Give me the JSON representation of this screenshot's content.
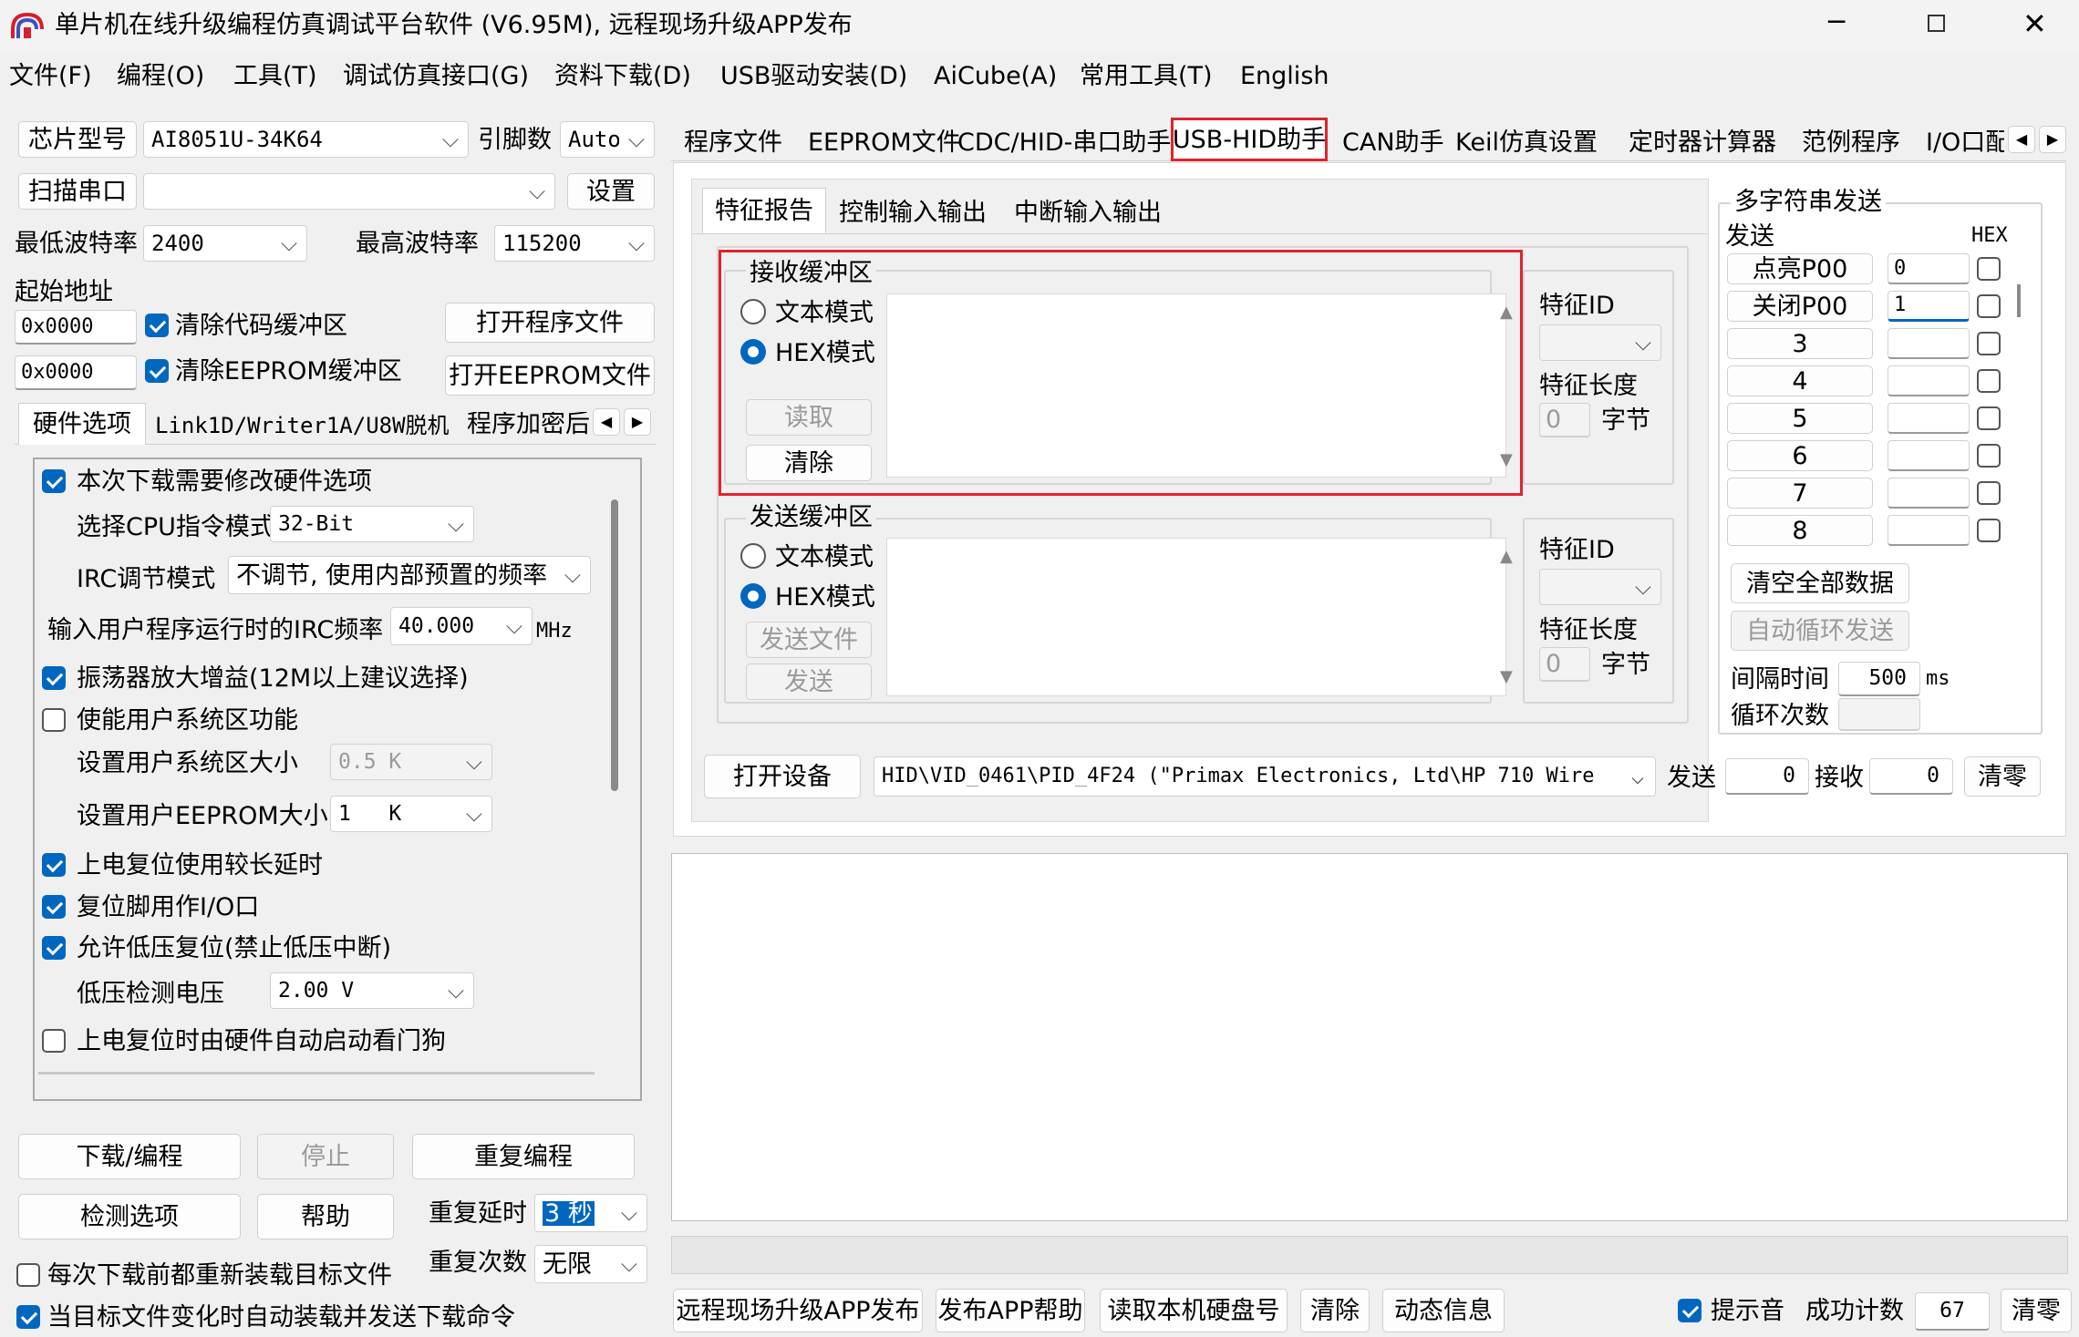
{
  "window": {
    "title": "单片机在线升级编程仿真调试平台软件 (V6.95M), 远程现场升级APP发布"
  },
  "menu": [
    "文件(F)",
    "编程(O)",
    "工具(T)",
    "调试仿真接口(G)",
    "资料下载(D)",
    "USB驱动安装(D)",
    "AiCube(A)",
    "常用工具(T)",
    "English"
  ],
  "left": {
    "chip_label": "芯片型号",
    "chip_value": "AI8051U-34K64",
    "pins_label": "引脚数",
    "pins_value": "Auto",
    "scan_label": "扫描串口",
    "port_value": "",
    "settings_label": "设置",
    "min_baud_label": "最低波特率",
    "min_baud_value": "2400",
    "max_baud_label": "最高波特率",
    "max_baud_value": "115200",
    "start_addr_label": "起始地址",
    "addr1": "0x0000",
    "clear_code": "清除代码缓冲区",
    "open_prog": "打开程序文件",
    "addr2": "0x0000",
    "clear_eeprom": "清除EEPROM缓冲区",
    "open_eeprom": "打开EEPROM文件",
    "tabs": [
      "硬件选项",
      "Link1D/Writer1A/U8W脱机",
      "程序加密后"
    ],
    "hw": {
      "opt1": "本次下载需要修改硬件选项",
      "cpu_label": "选择CPU指令模式",
      "cpu_value": "32-Bit",
      "irc_label": "IRC调节模式",
      "irc_value": "不调节, 使用内部预置的频率",
      "freq_label": "输入用户程序运行时的IRC频率",
      "freq_value": "40.000",
      "freq_unit": "MHz",
      "opt2": "振荡器放大增益(12M以上建议选择)",
      "opt3": "使能用户系统区功能",
      "sys_size_label": "设置用户系统区大小",
      "sys_size_value": "0.5 K",
      "eeprom_size_label": "设置用户EEPROM大小",
      "eeprom_size_value": "1   K",
      "opt4": "上电复位使用较长延时",
      "opt5": "复位脚用作I/O口",
      "opt6": "允许低压复位(禁止低压中断)",
      "lvd_label": "低压检测电压",
      "lvd_value": "2.00 V",
      "opt7": "上电复位时由硬件自动启动看门狗"
    },
    "download": "下载/编程",
    "stop": "停止",
    "reprogram": "重复编程",
    "check_opts": "检测选项",
    "help": "帮助",
    "repeat_delay_label": "重复延时",
    "repeat_delay_value": "3 秒",
    "repeat_count_label": "重复次数",
    "repeat_count_value": "无限",
    "reload_each": "每次下载前都重新装载目标文件",
    "auto_reload": "当目标文件变化时自动装载并发送下载命令"
  },
  "tabs": [
    "程序文件",
    "EEPROM文件",
    "CDC/HID-串口助手",
    "USB-HID助手",
    "CAN助手",
    "Keil仿真设置",
    "定时器计算器",
    "范例程序",
    "I/O口配"
  ],
  "hid": {
    "subtabs": [
      "特征报告",
      "控制输入输出",
      "中断输入输出"
    ],
    "recv": {
      "title": "接收缓冲区",
      "text_mode": "文本模式",
      "hex_mode": "HEX模式",
      "read": "读取",
      "clear": "清除",
      "feature_id": "特征ID",
      "feature_len": "特征长度",
      "len_value": "0",
      "unit": "字节"
    },
    "send": {
      "title": "发送缓冲区",
      "text_mode": "文本模式",
      "hex_mode": "HEX模式",
      "send_file": "发送文件",
      "send": "发送",
      "feature_id": "特征ID",
      "feature_len": "特征长度",
      "len_value": "0",
      "unit": "字节"
    },
    "open_device": "打开设备",
    "device": "HID\\VID_0461\\PID_4F24 (\"Primax Electronics, Ltd\\HP 710 Wire",
    "send_label": "发送",
    "send_count": "0",
    "recv_label": "接收",
    "recv_count": "0",
    "clear_counts": "清零"
  },
  "multi": {
    "title": "多字符串发送",
    "send_label": "发送",
    "hex_label": "HEX",
    "rows": [
      {
        "btn": "点亮P00",
        "val": "0"
      },
      {
        "btn": "关闭P00",
        "val": "1"
      },
      {
        "btn": "3",
        "val": ""
      },
      {
        "btn": "4",
        "val": ""
      },
      {
        "btn": "5",
        "val": ""
      },
      {
        "btn": "6",
        "val": ""
      },
      {
        "btn": "7",
        "val": ""
      },
      {
        "btn": "8",
        "val": ""
      }
    ],
    "clear_all": "清空全部数据",
    "auto_loop": "自动循环发送",
    "interval_label": "间隔时间",
    "interval_value": "500",
    "interval_unit": "ms",
    "loop_count_label": "循环次数"
  },
  "bottom": {
    "remote": "远程现场升级APP发布",
    "publish_help": "发布APP帮助",
    "read_disk": "读取本机硬盘号",
    "clear": "清除",
    "dynamic": "动态信息",
    "beep": "提示音",
    "success_label": "成功计数",
    "success_value": "67",
    "reset": "清零"
  }
}
